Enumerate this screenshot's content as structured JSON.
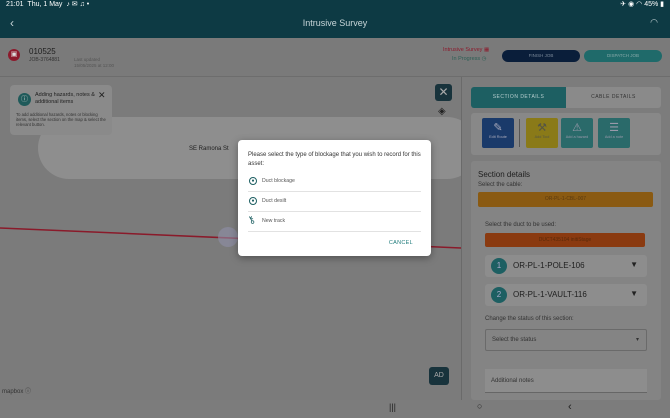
{
  "statusbar": {
    "time": "21:01",
    "date": "Thu, 1 May",
    "battery": "45%"
  },
  "titlebar": {
    "title": "Intrusive Survey"
  },
  "header": {
    "asset_id": "010525",
    "asset_sub": "JOB-3764881",
    "updated": "Last updated\n15/05/2025 at 12:00",
    "survey_type": "Intrusive Survey",
    "survey_status": "In Progress",
    "btn_primary": "FINISH JOB",
    "btn_secondary": "DISPATCH JOB"
  },
  "map": {
    "street": "SE Ramona St",
    "hint_title": "Adding hazards, notes & additional items",
    "hint_body": "To add additional hazards, notes or blocking items, select the section on the map & select the relevant button.",
    "badge": "AD",
    "attribution": "mapbox"
  },
  "panel": {
    "tab_section": "SECTION DETAILS",
    "tab_cable": "CABLE DETAILS",
    "actions": [
      {
        "icon": "edit",
        "label": "Edit Route"
      },
      {
        "icon": "tool",
        "label": "Add Tool"
      },
      {
        "icon": "warning",
        "label": "Add a hazard"
      },
      {
        "icon": "note",
        "label": "Add a note"
      }
    ],
    "section_title": "Section details",
    "select_cable": "Select the cable:",
    "cable_value": "OR-PL-1-CBL-007",
    "select_duct": "Select the duct to be used:",
    "duct_value": "DUCT435104 initiStage",
    "poles": [
      {
        "num": "1",
        "name": "OR-PL-1-POLE-106"
      },
      {
        "num": "2",
        "name": "OR-PL-1-VAULT-116"
      }
    ],
    "status_label": "Change the status of this section:",
    "status_placeholder": "Select the status",
    "notes_placeholder": "Additional notes"
  },
  "modal": {
    "prompt": "Please select the type of blockage that you wish to record for this asset:",
    "options": [
      "Duct blockage",
      "Duct desilt",
      "New track"
    ],
    "cancel": "CANCEL"
  }
}
